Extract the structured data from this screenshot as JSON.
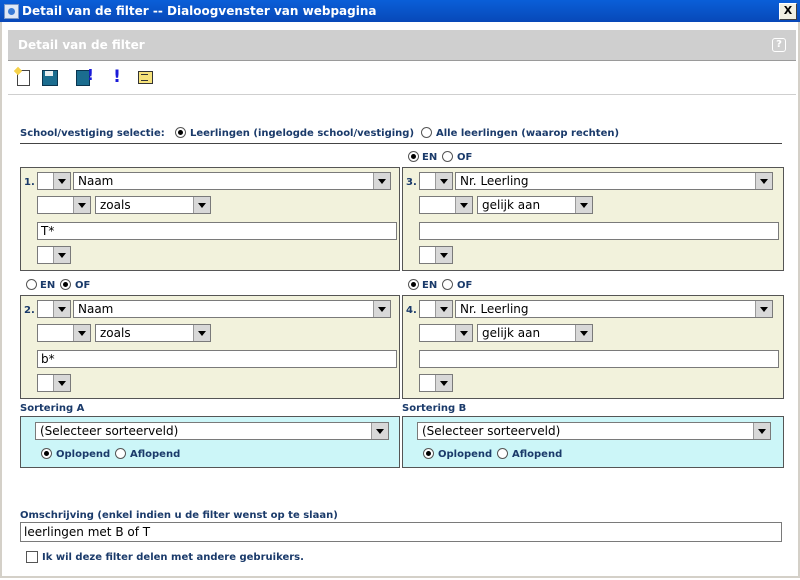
{
  "window": {
    "title": "Detail van de filter -- Dialoogvenster van webpagina",
    "close_label": "X"
  },
  "header": {
    "title": "Detail van de filter",
    "help_label": "?"
  },
  "toolbar": {
    "items": [
      {
        "icon": "new-document-icon"
      },
      {
        "icon": "save-icon"
      },
      {
        "icon": "save-as-icon"
      },
      {
        "icon": "run-icon",
        "label": "!"
      },
      {
        "icon": "list-icon"
      }
    ]
  },
  "school": {
    "label": "School/vestiging selectie:",
    "options": [
      "Leerlingen (ingelogde school/vestiging)",
      "Alle leerlingen (waarop rechten)"
    ],
    "selected": 0
  },
  "connectors": {
    "en": "EN",
    "of": "OF"
  },
  "filters": [
    {
      "number": "1.",
      "field": "Naam",
      "operator": "zoals",
      "value": "T*"
    },
    {
      "number": "2.",
      "field": "Naam",
      "operator": "zoals",
      "value": "b*",
      "connector": "OF"
    },
    {
      "number": "3.",
      "field": "Nr. Leerling",
      "operator": "gelijk aan",
      "value": "",
      "connector": "EN"
    },
    {
      "number": "4.",
      "field": "Nr. Leerling",
      "operator": "gelijk aan",
      "value": "",
      "connector": "EN"
    }
  ],
  "sorting": [
    {
      "label": "Sortering A",
      "field": "(Selecteer sorteerveld)",
      "options": [
        "Oplopend",
        "Aflopend"
      ],
      "selected": 0
    },
    {
      "label": "Sortering B",
      "field": "(Selecteer sorteerveld)",
      "options": [
        "Oplopend",
        "Aflopend"
      ],
      "selected": 0
    }
  ],
  "description": {
    "label": "Omschrijving (enkel indien u de filter wenst op te slaan)",
    "value": "leerlingen met B of T"
  },
  "share": {
    "label": "Ik wil deze filter delen met andere gebruikers.",
    "checked": false
  },
  "colors": {
    "filter_bg": "#f2f2dc",
    "sort_bg": "#ccf6f8",
    "label": "#1a3a6a",
    "titlebar": "#0a5fd8"
  }
}
